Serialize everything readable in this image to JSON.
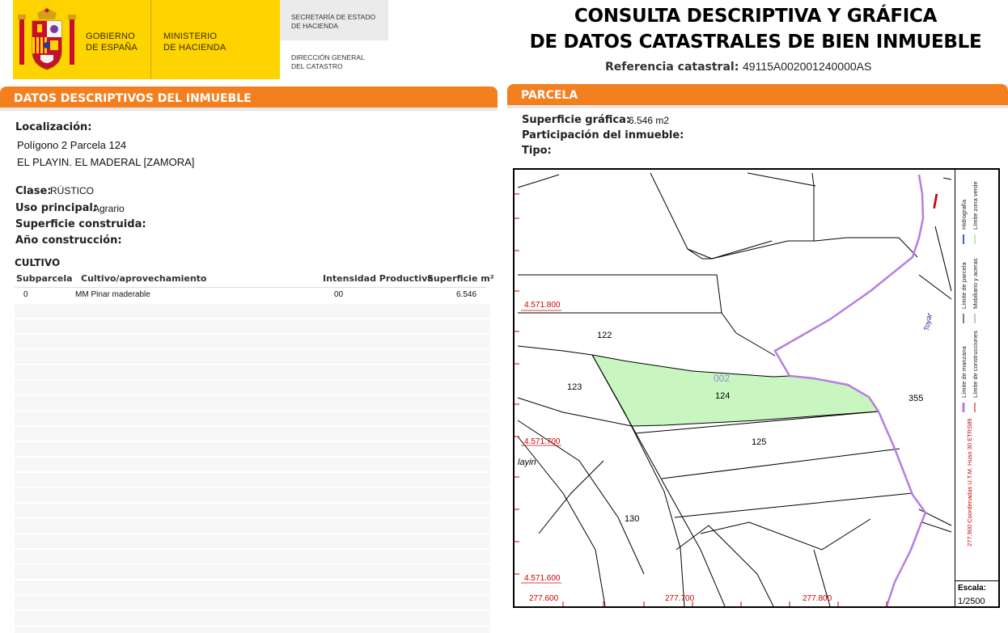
{
  "header": {
    "gov_line1": "GOBIERNO",
    "gov_line2": "DE ESPAÑA",
    "min_line1": "MINISTERIO",
    "min_line2": "DE HACIENDA",
    "sec_line1": "SECRETARÍA DE ESTADO",
    "sec_line2": "DE HACIENDA",
    "dg_line1": "DIRECCIÓN GENERAL",
    "dg_line2": "DEL CATASTRO",
    "title_line1": "CONSULTA DESCRIPTIVA Y GRÁFICA",
    "title_line2": "DE DATOS CATASTRALES DE BIEN INMUEBLE",
    "ref_label": "Referencia catastral:",
    "ref_value": "49115A002001240000AS"
  },
  "left": {
    "section_title": "DATOS DESCRIPTIVOS DEL INMUEBLE",
    "localizacion_label": "Localización:",
    "localizacion_line1": "Polígono 2 Parcela 124",
    "localizacion_line2": "EL PLAYIN. EL MADERAL [ZAMORA]",
    "clase_label": "Clase:",
    "clase_value": "RÚSTICO",
    "uso_label": "Uso principal:",
    "uso_value": "Agrario",
    "superficie_label": "Superficie construida:",
    "anio_label": "Año construcción:",
    "cultivo_title": "CULTIVO",
    "table_headers": [
      "Subparcela",
      "Cultivo/aprovechamiento",
      "Intensidad Productiva",
      "Superficie m²"
    ],
    "table_rows": [
      [
        "0",
        "MM Pinar maderable",
        "00",
        "6.546"
      ]
    ]
  },
  "right": {
    "section_title": "PARCELA",
    "superficie_label": "Superficie gráfica:",
    "superficie_value": "6.546 m2",
    "participacion_label": "Participación del inmueble:",
    "tipo_label": "Tipo:",
    "map": {
      "y_labels": [
        "4.571.800",
        "4.571.700",
        "4.571.600"
      ],
      "x_labels": [
        "277.600",
        "277.700",
        "277.800"
      ],
      "parcel_labels": [
        "122",
        "123",
        "124",
        "125",
        "130",
        "355"
      ],
      "subparcel_label": "002",
      "place_label": "layin",
      "river_label": "Toyar",
      "highlight_color": "#c8f5c0",
      "boundary_color": "#b77ee0",
      "grid_color": "#cc0000"
    },
    "legend": {
      "items": [
        "Límite de manzana",
        "Límite de parcela",
        "Límite de construcciones",
        "Mobiliario y aceras",
        "Límite zona verde",
        "Hidrografía"
      ],
      "coords": "277.900 Coordenadas U.T.M. Huso 30 ETRS89"
    },
    "scale_label": "Escala:",
    "scale_value": "1/2500"
  }
}
